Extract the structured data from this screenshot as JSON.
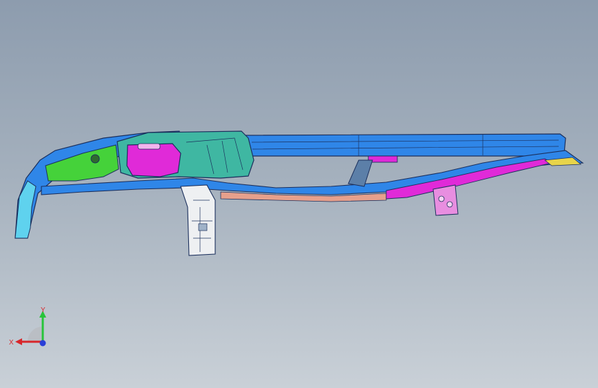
{
  "viewport": {
    "background_top": "#8d9cae",
    "background_bottom": "#c9d0d7"
  },
  "model": {
    "colors": {
      "outline": "#1b2f5c",
      "blue": "#2f86e8",
      "teal": "#3fb7a2",
      "green": "#45d23a",
      "magenta": "#e02ad8",
      "salmon": "#e6a08c",
      "white": "#eef0f2",
      "cyan": "#5fd2ee",
      "yellow": "#e8d44a"
    }
  },
  "triad": {
    "x_label": "X",
    "y_label": "Y",
    "x_color": "#d8262a",
    "y_color": "#27c43a",
    "z_color": "#2a3fd8"
  }
}
